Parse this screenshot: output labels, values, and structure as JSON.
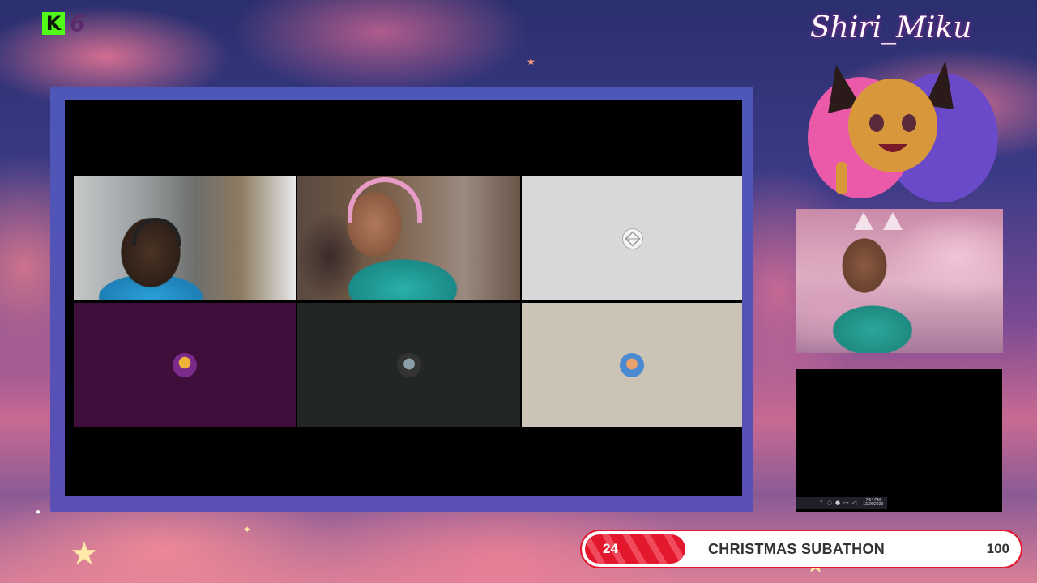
{
  "platform": {
    "logo_letter": "K",
    "viewer_count": "6",
    "brand_color": "#53fc18"
  },
  "overlay": {
    "streamer_name": "Shiri_Miku"
  },
  "call_grid": {
    "tiles": [
      {
        "kind": "video",
        "icon": "participant-video"
      },
      {
        "kind": "video",
        "icon": "participant-video"
      },
      {
        "kind": "placeholder",
        "icon": "app-placeholder-icon",
        "bg": "#d8d8d8"
      },
      {
        "kind": "avatar",
        "icon": "user-avatar-icon",
        "bg": "#3f0e3a"
      },
      {
        "kind": "avatar",
        "icon": "user-avatar-icon",
        "bg": "#222625"
      },
      {
        "kind": "avatar",
        "icon": "user-avatar-icon",
        "bg": "#cbc3b6"
      }
    ]
  },
  "mini_taskbar": {
    "time": "7:54 PM",
    "date": "12/26/2023"
  },
  "subathon": {
    "current": "24",
    "title": "CHRISTMAS SUBATHON",
    "goal": "100",
    "progress_fraction": 0.24,
    "accent": "#e3182d"
  }
}
